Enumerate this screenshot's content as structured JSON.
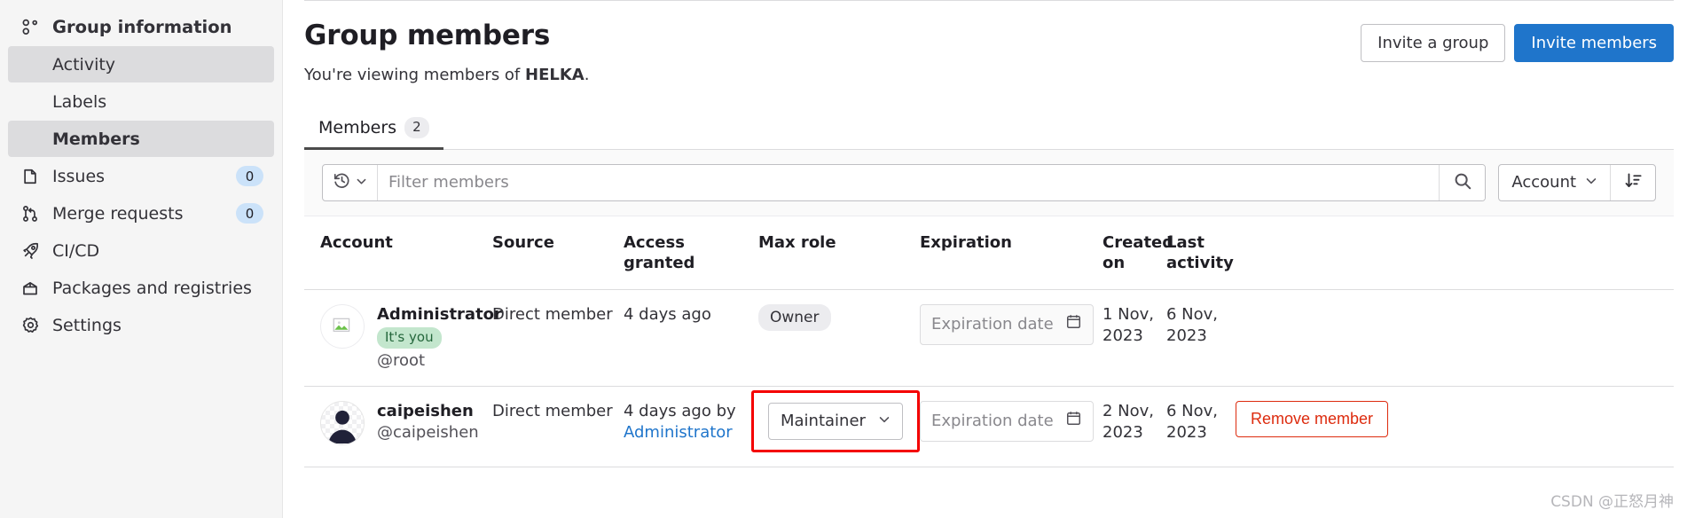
{
  "sidebar": {
    "items": [
      {
        "label": "Group information",
        "icon": "group-icon",
        "state": "top",
        "badge": null
      },
      {
        "label": "Activity",
        "icon": null,
        "state": "sub-active",
        "badge": null
      },
      {
        "label": "Labels",
        "icon": null,
        "state": "sub",
        "badge": null
      },
      {
        "label": "Members",
        "icon": null,
        "state": "sub-active-bold",
        "badge": null
      },
      {
        "label": "Issues",
        "icon": "issues-icon",
        "state": "normal",
        "badge": "0"
      },
      {
        "label": "Merge requests",
        "icon": "merge-request-icon",
        "state": "normal",
        "badge": "0"
      },
      {
        "label": "CI/CD",
        "icon": "rocket-icon",
        "state": "normal",
        "badge": null
      },
      {
        "label": "Packages and registries",
        "icon": "package-icon",
        "state": "normal",
        "badge": null
      },
      {
        "label": "Settings",
        "icon": "gear-icon",
        "state": "normal",
        "badge": null
      }
    ]
  },
  "header": {
    "title": "Group members",
    "subtitle_prefix": "You're viewing members of ",
    "subtitle_group": "HELKA",
    "subtitle_suffix": ".",
    "invite_group_label": "Invite a group",
    "invite_members_label": "Invite members"
  },
  "tabs": [
    {
      "label": "Members",
      "count": "2",
      "active": true
    }
  ],
  "filter": {
    "placeholder": "Filter members",
    "value": "",
    "history_icon": "history-icon",
    "search_icon": "search-icon",
    "sort_field": "Account",
    "sort_direction_icon": "sort-descending-icon"
  },
  "table": {
    "columns": [
      "Account",
      "Source",
      "Access granted",
      "Max role",
      "Expiration",
      "Created on",
      "Last activity",
      ""
    ],
    "rows": [
      {
        "avatar": "broken-image-avatar",
        "name": "Administrator",
        "you_badge": "It's you",
        "handle": "@root",
        "source": "Direct member",
        "access_granted": "4 days ago",
        "access_granted_by": null,
        "max_role": "Owner",
        "max_role_type": "static",
        "expiration_placeholder": "Expiration date",
        "created_on": "1 Nov, 2023",
        "last_activity": "6 Nov, 2023",
        "action": null
      },
      {
        "avatar": "person-avatar",
        "name": "caipeishen",
        "you_badge": null,
        "handle": "@caipeishen",
        "source": "Direct member",
        "access_granted": "4 days ago by",
        "access_granted_by": "Administrator",
        "max_role": "Maintainer",
        "max_role_type": "dropdown",
        "expiration_placeholder": "Expiration date",
        "created_on": "2 Nov, 2023",
        "last_activity": "6 Nov, 2023",
        "action": "Remove member"
      }
    ]
  },
  "watermark": "CSDN @正怒月神",
  "colors": {
    "accent_blue": "#1f75cb",
    "danger_red": "#dd2b0e",
    "highlight_red": "#f40000",
    "badge_green_bg": "#c3e6cd",
    "badge_green_text": "#24663b",
    "sidebar_bg": "#f5f5f5",
    "sidebar_active": "#dcdcde",
    "nav_badge_bg": "#cbe2f9"
  }
}
